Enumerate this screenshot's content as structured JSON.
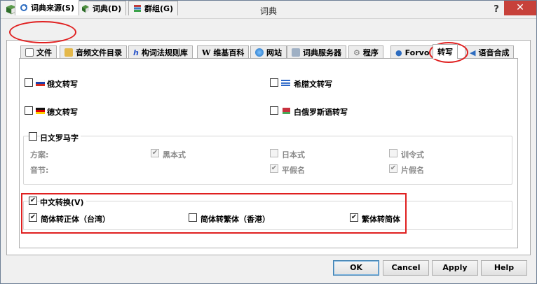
{
  "window": {
    "title": "词典",
    "help_glyph": "?",
    "close_glyph": "✕"
  },
  "top_tabs": [
    {
      "label": "词典来源(S)",
      "icon": "refresh-icon",
      "active": true
    },
    {
      "label": "词典(D)",
      "icon": "book-icon",
      "active": false
    },
    {
      "label": "群组(G)",
      "icon": "books-stack-icon",
      "active": false
    }
  ],
  "sub_tabs": [
    {
      "label": "文件",
      "icon": "file-icon"
    },
    {
      "label": "音频文件目录",
      "icon": "audio-folder-icon"
    },
    {
      "label": "构词法规则库",
      "icon": "morphology-icon"
    },
    {
      "label": "维基百科",
      "icon": "wikipedia-icon"
    },
    {
      "label": "网站",
      "icon": "globe-icon"
    },
    {
      "label": "词典服务器",
      "icon": "server-icon"
    },
    {
      "label": "程序",
      "icon": "gear-icon"
    },
    {
      "label": "Forvo",
      "icon": "forvo-icon"
    },
    {
      "label": "转写",
      "icon": "",
      "active": true
    },
    {
      "label": "语音合成",
      "icon": "speaker-icon"
    }
  ],
  "transliteration": {
    "russian": {
      "label": "俄文转写",
      "checked": false
    },
    "greek": {
      "label": "希腊文转写",
      "checked": false
    },
    "german": {
      "label": "德文转写",
      "checked": false
    },
    "belarusian": {
      "label": "白俄罗斯语转写",
      "checked": false
    }
  },
  "romaji": {
    "label": "日文罗马字",
    "checked": false,
    "scheme_label": "方案:",
    "syllable_label": "音节:",
    "hepburn": {
      "label": "黑本式",
      "checked": true
    },
    "nihon": {
      "label": "日本式",
      "checked": false
    },
    "kunrei": {
      "label": "训令式",
      "checked": false
    },
    "hiragana": {
      "label": "平假名",
      "checked": true
    },
    "katakana": {
      "label": "片假名",
      "checked": true
    }
  },
  "chinese": {
    "label": "中文转换(V)",
    "checked": true,
    "s2t_taiwan": {
      "label": "简体转正体（台湾）",
      "checked": true
    },
    "s2t_hk": {
      "label": "简体转繁体（香港）",
      "checked": false
    },
    "t2s": {
      "label": "繁体转简体",
      "checked": true
    }
  },
  "buttons": {
    "ok": "OK",
    "cancel": "Cancel",
    "apply": "Apply",
    "help": "Help"
  },
  "colors": {
    "highlight_red": "#e02020",
    "close_red": "#c7413a"
  }
}
